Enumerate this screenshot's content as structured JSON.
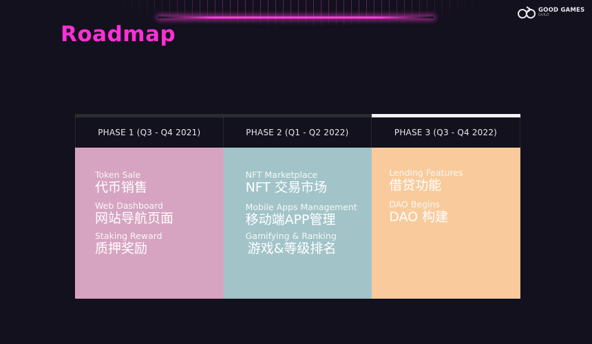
{
  "brand": {
    "name": "GOOD GAMES",
    "sub": "GUILD",
    "logo_icon": "ggg-logo-icon"
  },
  "title": "Roadmap",
  "colors": {
    "title": "#ff2fd6",
    "glow": "#ff3fd8",
    "background": "#12111d",
    "phase1": "#d6a4c1",
    "phase2": "#a2c4c9",
    "phase3": "#f9cb9c"
  },
  "phases": [
    {
      "label": "PHASE 1 (Q3 - Q4 2021)",
      "items": [
        {
          "en": "Token Sale",
          "zh": "代币销售"
        },
        {
          "en": "Web Dashboard",
          "zh": "网站导航页面"
        },
        {
          "en": "Staking Reward",
          "zh": "质押奖励"
        }
      ]
    },
    {
      "label": "PHASE 2 (Q1 - Q2 2022)",
      "items": [
        {
          "en": "NFT Marketplace",
          "zh": "NFT 交易市场"
        },
        {
          "en": "Mobile Apps Management",
          "zh": "移动端APP管理"
        },
        {
          "en": "Gamifying & Ranking",
          "zh": "游戏&等级排名"
        }
      ]
    },
    {
      "label": "PHASE 3 (Q3 - Q4 2022)",
      "items": [
        {
          "en": "Lending Features",
          "zh": "借贷功能"
        },
        {
          "en": "DAO Begins",
          "zh": "DAO 构建"
        }
      ]
    }
  ]
}
